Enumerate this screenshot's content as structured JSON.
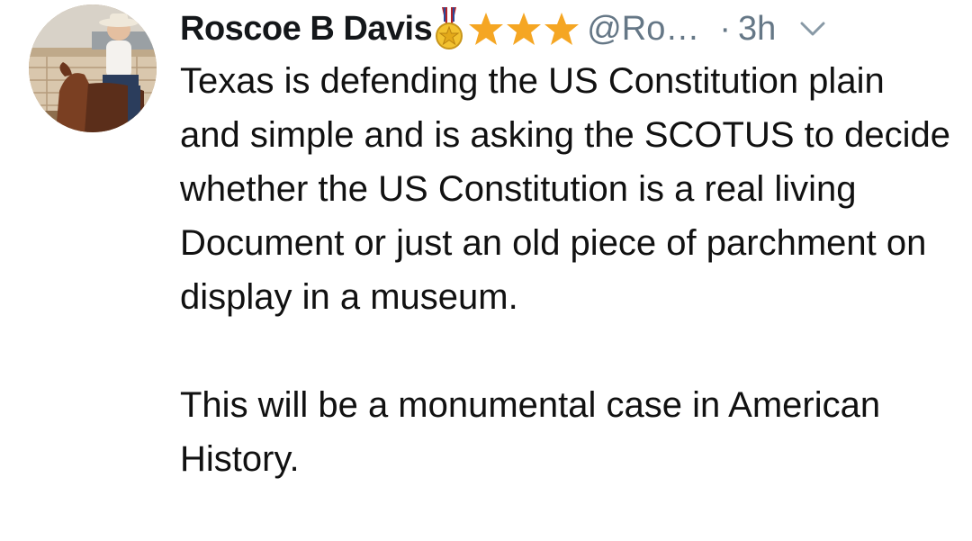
{
  "tweet": {
    "author_name": "Roscoe B Davis",
    "handle": "@Ro…",
    "separator": "·",
    "time": "3h",
    "badges": {
      "medal_icon": "medal-icon",
      "star_icon": "star-icon",
      "star_count": 3,
      "star_color": "#f5a623"
    },
    "menu_icon": "chevron-down-icon",
    "paragraphs": [
      "Texas is defending the US Constitution plain and simple and is asking the SCOTUS to decide whether the US Constitution is a real living Document or just an old piece of parchment on display in a museum.",
      "This will be a monumental case in American History."
    ]
  }
}
